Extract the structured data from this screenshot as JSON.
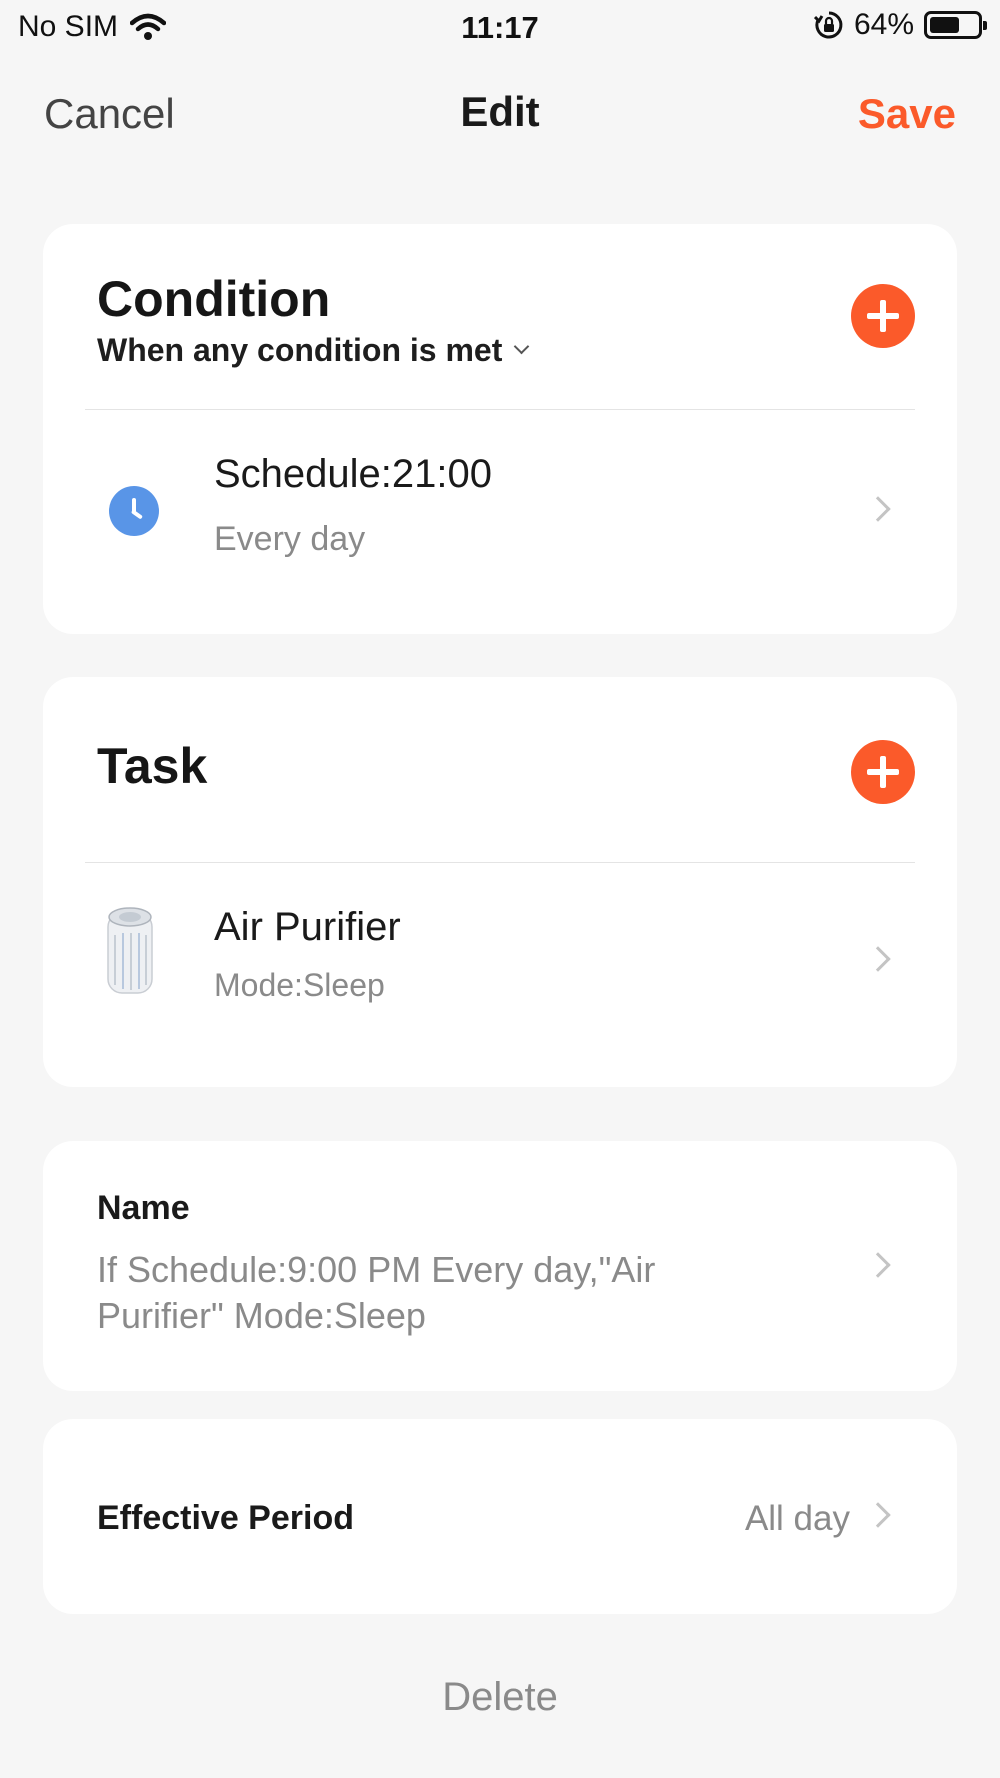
{
  "status_bar": {
    "carrier": "No SIM",
    "time": "11:17",
    "battery": "64%",
    "battery_level": 0.64,
    "icons": [
      "wifi-icon",
      "orientation-lock-icon",
      "battery-icon"
    ]
  },
  "nav": {
    "cancel": "Cancel",
    "title": "Edit",
    "save": "Save"
  },
  "condition": {
    "title": "Condition",
    "mode": "When any condition is met",
    "items": [
      {
        "icon": "clock-icon",
        "label": "Schedule:21:00",
        "detail": "Every day"
      }
    ]
  },
  "task": {
    "title": "Task",
    "items": [
      {
        "icon": "air-purifier-icon",
        "label": "Air Purifier",
        "detail": "Mode:Sleep"
      }
    ]
  },
  "name": {
    "label": "Name",
    "value": "If Schedule:9:00 PM Every day,\"Air Purifier\" Mode:Sleep"
  },
  "effective_period": {
    "label": "Effective Period",
    "value": "All day"
  },
  "delete_label": "Delete",
  "colors": {
    "accent": "#fb5a2a",
    "clock_blue": "#5995e7",
    "background": "#f6f6f6"
  }
}
